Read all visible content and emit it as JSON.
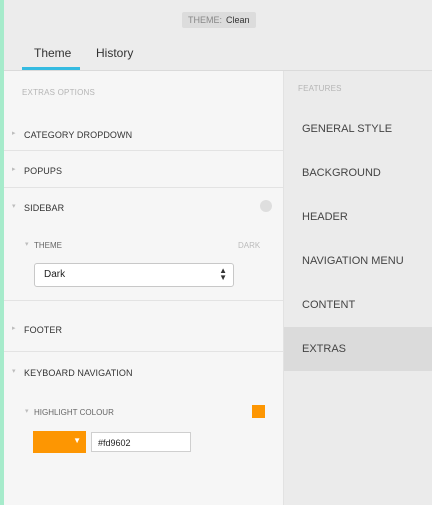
{
  "titlebar": {
    "theme_key": "THEME:",
    "theme_value": "Clean"
  },
  "tabs": [
    {
      "label": "Theme",
      "active": true
    },
    {
      "label": "History",
      "active": false
    }
  ],
  "left": {
    "caption": "EXTRAS OPTIONS",
    "rows": {
      "category_dropdown": "CATEGORY DROPDOWN",
      "popups": "POPUPS",
      "sidebar": "SIDEBAR",
      "footer": "FOOTER",
      "keyboard_navigation": "KEYBOARD NAVIGATION"
    },
    "sidebar_theme": {
      "label": "THEME",
      "tag": "DARK",
      "select_value": "Dark"
    },
    "highlight": {
      "label": "HIGHLIGHT COLOUR",
      "color": "#fd9602",
      "hex_value": "#fd9602"
    }
  },
  "right": {
    "caption": "FEATURES",
    "items": [
      {
        "label": "GENERAL STYLE",
        "active": false
      },
      {
        "label": "BACKGROUND",
        "active": false
      },
      {
        "label": "HEADER",
        "active": false
      },
      {
        "label": "NAVIGATION MENU",
        "active": false
      },
      {
        "label": "CONTENT",
        "active": false
      },
      {
        "label": "EXTRAS",
        "active": true
      }
    ]
  },
  "colors": {
    "accent_tab": "#35bbe1",
    "window_background": "#a6ebcb",
    "highlight": "#fd9602"
  }
}
